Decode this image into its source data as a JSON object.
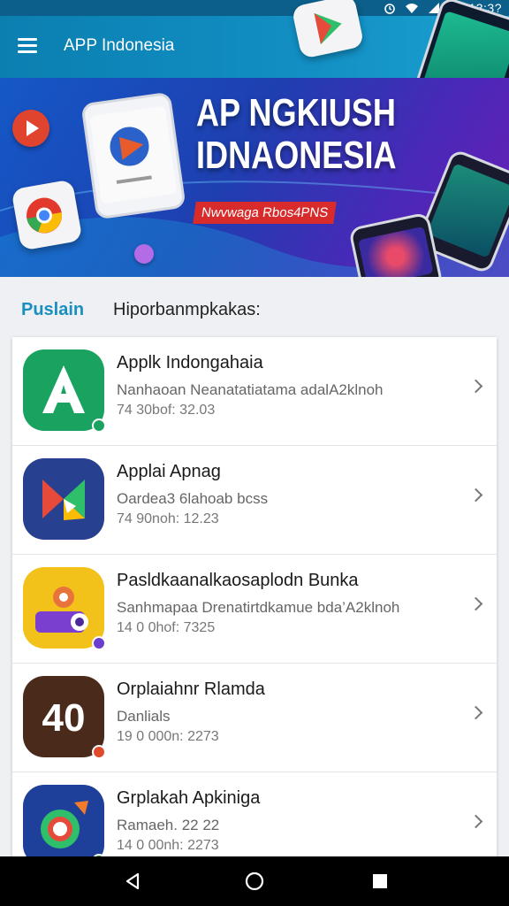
{
  "status_bar": {
    "time": "13:3?",
    "icons": [
      "alarm-icon",
      "wifi-icon",
      "signal-icon",
      "battery-icon"
    ]
  },
  "toolbar": {
    "title": "APP Indonesia",
    "menu_icon": "menu-icon"
  },
  "banner": {
    "title_line1": "AP NGKIUSH",
    "title_line2": "IDNAONESIA",
    "tagline": "Nwvwaga Rbos4PNS"
  },
  "list_header": {
    "left": "Puslain",
    "right": "Hiporbanmpkakas:"
  },
  "apps": [
    {
      "title": "Applk Indongahaia",
      "desc": "Nanhaoan Neanatatiatama adalA2klnoh",
      "meta": "74 30bof: 32.03",
      "color": "#1aa261",
      "badge": "#e04a2c"
    },
    {
      "title": "Applai Apnag",
      "desc": "Oardea3 6lahoab bcss",
      "meta": "74 90noh: 12.23",
      "color": "#27408f",
      "badge": ""
    },
    {
      "title": "Pasldkaanalkaosaplodn Bunka",
      "desc": "Sanhmapaa Drenatirtdkamue bda’A2klnoh",
      "meta": "14 0 0hof: 7325",
      "color": "#f3c21a",
      "badge": "#6a3fd0"
    },
    {
      "title": "Orplaiahnr Rlamda",
      "desc": "Danlials",
      "meta": "19 0 000n: 2273",
      "color": "#4a2a1b",
      "badge": "#e04a2c"
    },
    {
      "title": "Grplakah Apkiniga",
      "desc": "Ramaeh. 22 22",
      "meta": "14 0 00nh: 2273",
      "color": "#1e3f9a",
      "badge": "#2a9b4a"
    }
  ],
  "nav": {
    "back": "back-icon",
    "home": "home-icon",
    "recents": "recents-icon"
  }
}
